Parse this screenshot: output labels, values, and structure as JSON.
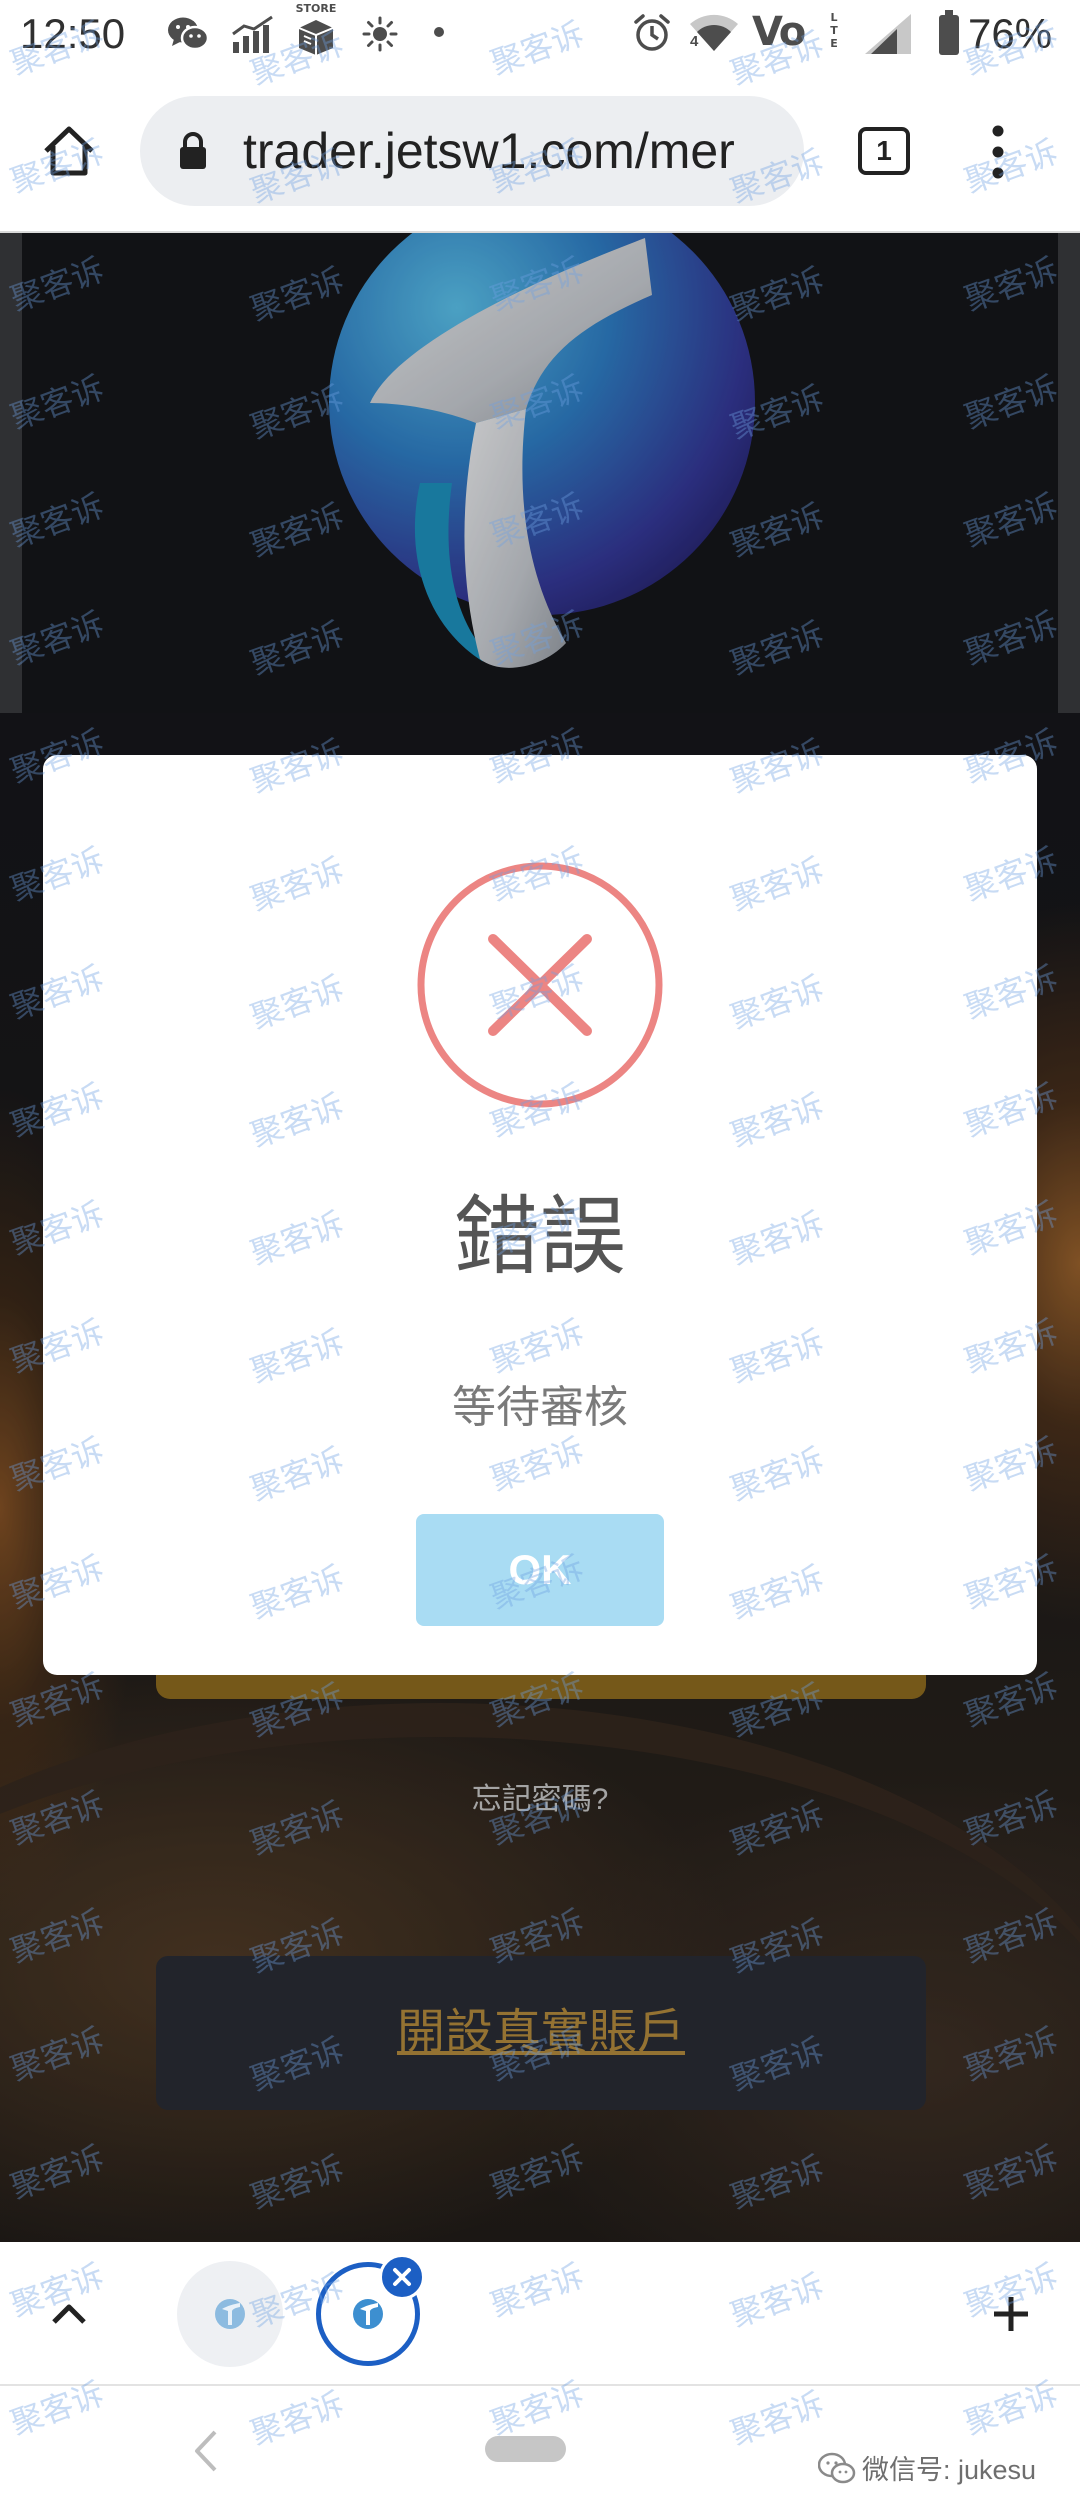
{
  "status_bar": {
    "time": "12:50",
    "battery": "76%",
    "store_label": "STORE",
    "wifi_badge": "4",
    "volte_label": "Vo",
    "lte_label": "LTE",
    "icons": [
      "wechat-icon",
      "stats-icon",
      "store-icon",
      "brightness-icon",
      "dot-icon",
      "alarm-icon",
      "wifi-icon",
      "volte-icon",
      "signal-icon",
      "battery-icon"
    ]
  },
  "browser": {
    "url": "trader.jetsw1.com/mer",
    "tab_count": "1",
    "icons": [
      "home-icon",
      "lock-icon",
      "more-vert-icon"
    ]
  },
  "page": {
    "logo": "brand-logo",
    "forgot_password": "忘記密碼?",
    "open_account": "開設真實賬戶"
  },
  "dialog": {
    "icon": "error-x-icon",
    "title": "錯誤",
    "message": "等待審核",
    "confirm_label": "OK"
  },
  "tab_strip": {
    "icons": [
      "chevron-up-icon",
      "site-favicon-icon",
      "close-icon",
      "plus-icon"
    ]
  },
  "nav_bar": {
    "icons": [
      "back-icon",
      "home-pill",
      "wechat-icon"
    ],
    "wechat_id": "微信号: jukesu"
  },
  "watermark": "聚客诉",
  "colors": {
    "error": "#ec8583",
    "confirm_button": "#a9dcf3",
    "gold_text": "#b58c3d",
    "login_button": "#8f6c1f",
    "active_tab": "#1c5fc4"
  }
}
